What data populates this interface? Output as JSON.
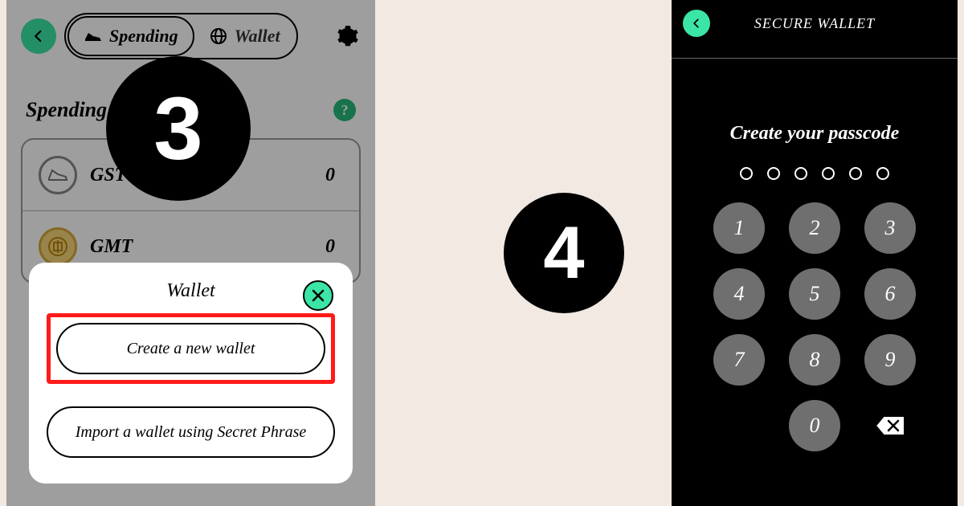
{
  "steps": {
    "left": "3",
    "right": "4"
  },
  "left": {
    "tabs": {
      "spending": "Spending",
      "wallet": "Wallet"
    },
    "section_title": "Spending Account",
    "help": "?",
    "assets": [
      {
        "name": "GST",
        "value": "0"
      },
      {
        "name": "GMT",
        "value": "0"
      }
    ],
    "sheet": {
      "title": "Wallet",
      "create": "Create a new wallet",
      "import": "Import a wallet using Secret Phrase"
    }
  },
  "right": {
    "header": "SECURE WALLET",
    "title": "Create your passcode",
    "passcode_length": 6,
    "keys": [
      "1",
      "2",
      "3",
      "4",
      "5",
      "6",
      "7",
      "8",
      "9",
      "",
      "0",
      "del"
    ]
  }
}
